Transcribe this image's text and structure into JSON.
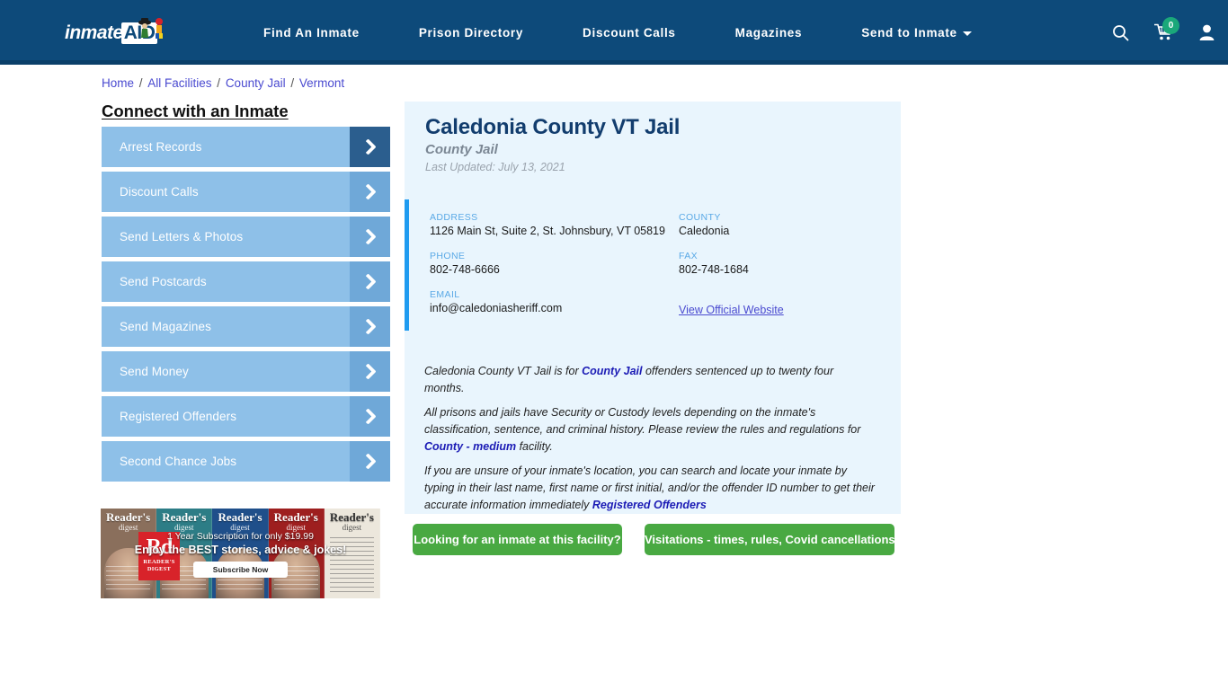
{
  "header": {
    "logo": {
      "text": "inmate",
      "highlight": "AID",
      "alt": "inmateAID logo"
    },
    "nav": [
      {
        "label": "Find An Inmate",
        "dropdown": false
      },
      {
        "label": "Prison Directory",
        "dropdown": false
      },
      {
        "label": "Discount Calls",
        "dropdown": false
      },
      {
        "label": "Magazines",
        "dropdown": false
      },
      {
        "label": "Send to Inmate",
        "dropdown": true
      }
    ],
    "icons": {
      "search": "search-icon",
      "cart": "cart-icon",
      "cart_count": "0",
      "account": "user-icon"
    },
    "colors": {
      "background": "#0d4a7a",
      "badge": "#1aa87a"
    }
  },
  "breadcrumb": {
    "items": [
      "Home",
      "All Facilities",
      "County Jail",
      "Vermont"
    ],
    "separator": "/"
  },
  "sidebar": {
    "title": "Connect with an Inmate",
    "items": [
      {
        "label": "Arrest Records",
        "active": true
      },
      {
        "label": "Discount Calls",
        "active": false
      },
      {
        "label": "Send Letters & Photos",
        "active": false
      },
      {
        "label": "Send Postcards",
        "active": false
      },
      {
        "label": "Send Magazines",
        "active": false
      },
      {
        "label": "Send Money",
        "active": false
      },
      {
        "label": "Registered Offenders",
        "active": false
      },
      {
        "label": "Second Chance Jobs",
        "active": false
      }
    ]
  },
  "ad": {
    "brand": "Reader's Digest",
    "brand_short_top": "Rd",
    "brand_short_bottom_1": "READER'S",
    "brand_short_bottom_2": "DIGEST",
    "line1": "1 Year Subscription for only $19.99",
    "line2": "Enjoy the BEST stories, advice & jokes!",
    "cta": "Subscribe Now",
    "covers": [
      {
        "title": "Reader's",
        "sub": "digest"
      },
      {
        "title": "Reader's",
        "sub": "digest"
      },
      {
        "title": "Reader's",
        "sub": "digest"
      },
      {
        "title": "Reader's",
        "sub": "digest"
      },
      {
        "title": "Reader's",
        "sub": "digest"
      }
    ]
  },
  "facility": {
    "name": "Caledonia County VT Jail",
    "type": "County Jail",
    "last_updated": "Last Updated: July 13, 2021",
    "contact": {
      "address_label": "ADDRESS",
      "address_value": "1126 Main St, Suite 2, St. Johnsbury, VT 05819",
      "county_label": "COUNTY",
      "county_value": "Caledonia",
      "phone_label": "PHONE",
      "phone_value": "802-748-6666",
      "fax_label": "FAX",
      "fax_value": "802-748-1684",
      "email_label": "EMAIL",
      "email_value": "info@caledoniasheriff.com",
      "website_link": "View Official Website"
    },
    "description": {
      "p1_a": "Caledonia County VT Jail is for ",
      "p1_link": "County Jail",
      "p1_b": " offenders sentenced up to twenty four months.",
      "p2_a": "All prisons and jails have Security or Custody levels depending on the inmate's classification, sentence, and criminal history. Please review the rules and regulations for ",
      "p2_link": "County - medium",
      "p2_b": " facility.",
      "p3_a": "If you are unsure of your inmate's location, you can search and locate your inmate by typing in their last name, first name or first initial, and/or the offender ID number to get their accurate information immediately ",
      "p3_link": "Registered Offenders"
    },
    "buttons": {
      "find_inmate": "Looking for an inmate at this facility?",
      "visitations": "Visitations - times, rules, Covid cancellations"
    }
  },
  "colors": {
    "nav_blue": "#0d4a7a",
    "panel_bg": "#e9f5fd",
    "accent_bar": "#1e9bf0",
    "green_button": "#49a942",
    "sidebar_button": "#8ec0e8",
    "sidebar_arrow": "#6fa8d8",
    "sidebar_arrow_active": "#2b5e8e",
    "title_navy": "#123d6e",
    "link_blue": "#4a4ad0"
  }
}
